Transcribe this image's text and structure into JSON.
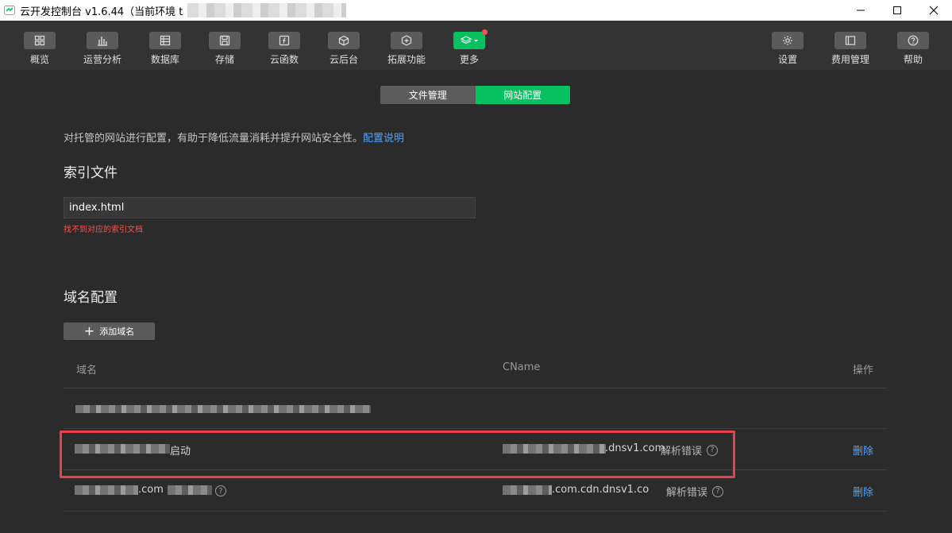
{
  "window": {
    "title": "云开发控制台 v1.6.44（当前环境 t",
    "controls": [
      "minimize",
      "maximize",
      "close"
    ]
  },
  "toolbar": {
    "items": [
      {
        "label": "概览",
        "icon": "grid-icon"
      },
      {
        "label": "运营分析",
        "icon": "bar-chart-icon"
      },
      {
        "label": "数据库",
        "icon": "database-icon"
      },
      {
        "label": "存储",
        "icon": "save-icon"
      },
      {
        "label": "云函数",
        "icon": "function-icon"
      },
      {
        "label": "云后台",
        "icon": "cube-icon"
      },
      {
        "label": "拓展功能",
        "icon": "extension-icon"
      },
      {
        "label": "更多",
        "icon": "layers-icon"
      }
    ],
    "right_items": [
      {
        "label": "设置",
        "icon": "gear-icon"
      },
      {
        "label": "费用管理",
        "icon": "billing-icon"
      },
      {
        "label": "帮助",
        "icon": "help-icon"
      }
    ]
  },
  "tabs": {
    "file_mgmt": "文件管理",
    "site_config": "网站配置",
    "active": "网站配置"
  },
  "intro": {
    "text": "对托管的网站进行配置，有助于降低流量消耗并提升网站安全性。",
    "link": "配置说明"
  },
  "index_section": {
    "title": "索引文件",
    "value": "index.html",
    "error": "找不到对应的索引文档"
  },
  "domain_section": {
    "title": "域名配置",
    "add_button": "添加域名",
    "columns": {
      "domain": "域名",
      "cname": "CName",
      "action": "操作"
    },
    "rows": [
      {
        "domain_suffix": "",
        "cname_suffix": "",
        "status": "",
        "action": ""
      },
      {
        "domain_suffix": "启动",
        "cname_suffix": ".dnsv1.com",
        "status": "解析错误",
        "action": "删除"
      },
      {
        "domain_suffix": ".com",
        "cname_suffix": ".com.cdn.dnsv1.co",
        "status": "解析错误",
        "action": "删除"
      }
    ]
  },
  "colors": {
    "accent_green": "#07c160",
    "link_blue": "#4fa3ff",
    "error_red": "#fa5151",
    "highlight_red": "#e9424a"
  }
}
